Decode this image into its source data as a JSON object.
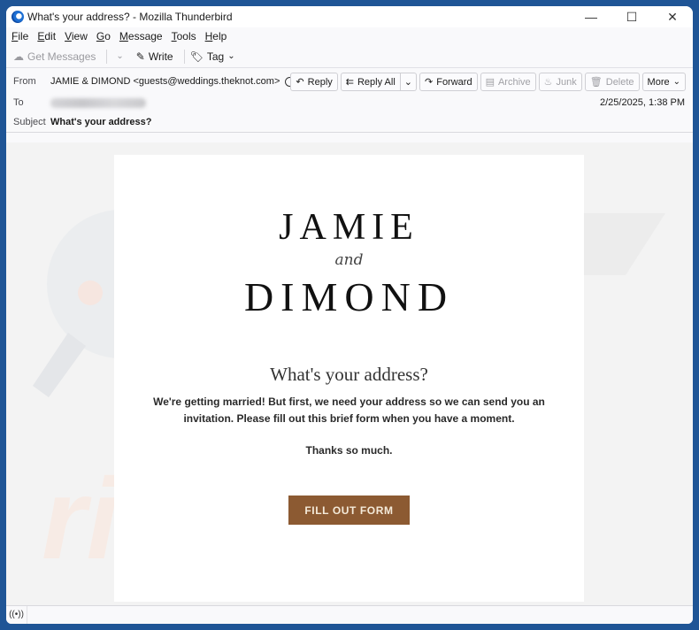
{
  "window": {
    "title": "What's your address? - Mozilla Thunderbird",
    "controls": {
      "minimize": "—",
      "maximize": "☐",
      "close": "✕"
    }
  },
  "menubar": {
    "items": [
      {
        "accel": "F",
        "rest": "ile"
      },
      {
        "accel": "E",
        "rest": "dit"
      },
      {
        "accel": "V",
        "rest": "iew"
      },
      {
        "accel": "G",
        "rest": "o"
      },
      {
        "accel": "M",
        "rest": "essage"
      },
      {
        "accel": "T",
        "rest": "ools"
      },
      {
        "accel": "H",
        "rest": "elp"
      }
    ]
  },
  "toolbar": {
    "get_messages": "Get Messages",
    "write": "Write",
    "tag": "Tag"
  },
  "header": {
    "from_label": "From",
    "from_value": "JAMIE & DIMOND <guests@weddings.theknot.com>",
    "to_label": "To",
    "subject_label": "Subject",
    "subject_value": "What's your address?",
    "date": "2/25/2025, 1:38 PM",
    "actions": {
      "reply": "Reply",
      "reply_all": "Reply All",
      "forward": "Forward",
      "archive": "Archive",
      "junk": "Junk",
      "delete": "Delete",
      "more": "More"
    }
  },
  "email": {
    "name1": "JAMIE",
    "and": "and",
    "name2": "DIMOND",
    "headline": "What's your address?",
    "body": "We're getting married! But first, we need your address so we can send you an invitation. Please fill out this brief form when you have a moment.",
    "thanks": "Thanks so much.",
    "cta_label": "FILL OUT FORM",
    "cta_color": "#8c5a32"
  },
  "watermark": {
    "text": "risk.com"
  }
}
